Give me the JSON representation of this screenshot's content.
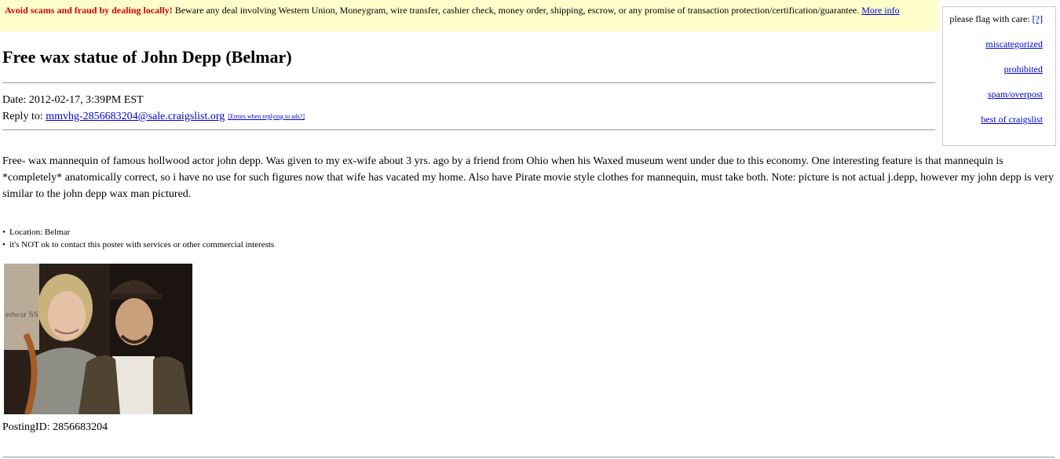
{
  "warning": {
    "alert_text": "Avoid scams and fraud by dealing locally!",
    "text": " Beware any deal involving Western Union, Moneygram, wire transfer, cashier check, money order, shipping, escrow, or any promise of transaction protection/certification/guarantee. ",
    "more_info_link": "More info"
  },
  "flag_box": {
    "label": "please flag with care: ",
    "help_link": "[?]",
    "flags": [
      "miscategorized",
      "prohibited",
      "spam/overpost",
      "best of craigslist"
    ]
  },
  "post": {
    "title": "Free wax statue of John Depp (Belmar)",
    "date_line": "Date: 2012-02-17, 3:39PM EST",
    "reply_label": "Reply to: ",
    "reply_email": "mmvhg-2856683204@sale.craigslist.org",
    "errors_link": "[Errors when replying to ads?]",
    "body": "Free- wax mannequin of famous hollwood actor john depp. Was given to my ex-wife about 3 yrs. ago by a friend from Ohio when his Waxed museum went under due to this economy. One interesting feature is that mannequin is *completely* anatomically correct, so i have no use for such figures now that wife has vacated my home. Also have Pirate movie style clothes for mannequin, must take both. Note: picture is not actual j.depp, however my john depp is very similar to the john depp wax man pictured.",
    "facts": [
      "Location: Belmar",
      "it's NOT ok to contact this poster with services or other commercial interests"
    ],
    "photo_sign_text": "edwar SSOR",
    "posting_id": "PostingID: 2856683204"
  }
}
